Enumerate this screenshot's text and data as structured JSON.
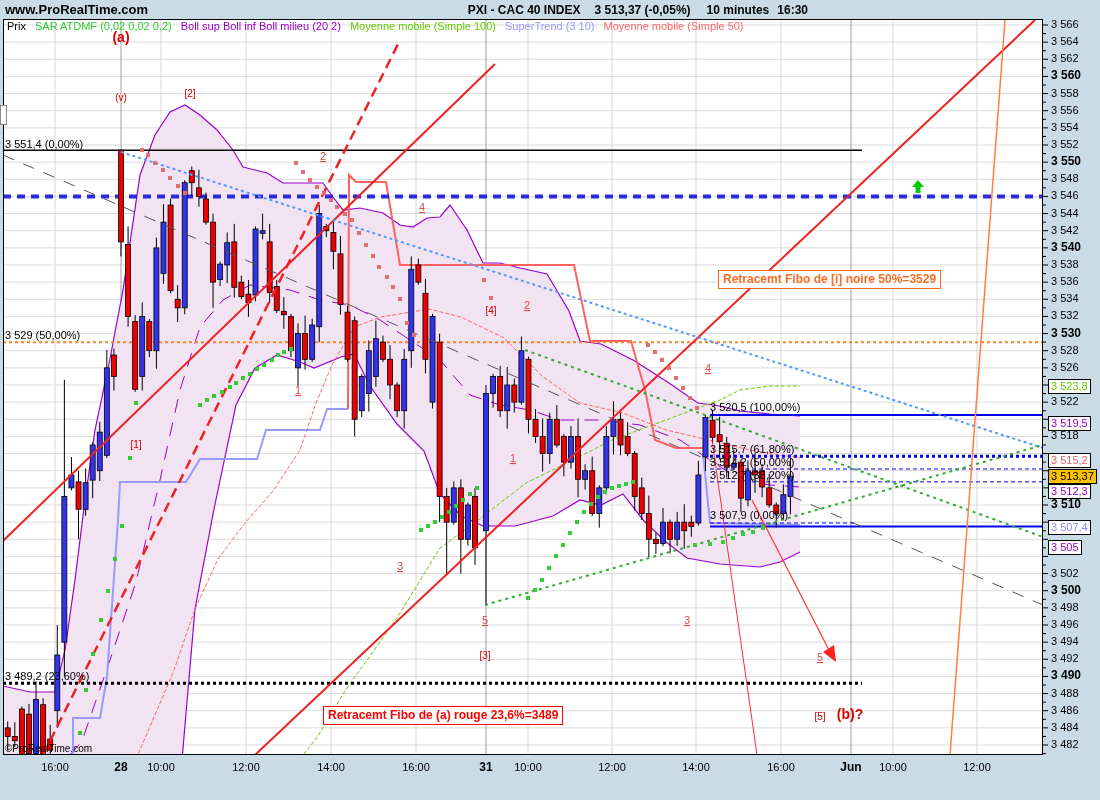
{
  "header": {
    "site": "www.ProRealTime.com",
    "instrument": "PXI - CAC 40 INDEX",
    "quote": "3 513,37 (-0,05%)",
    "timeframe": "10 minutes",
    "time": "16:30"
  },
  "legend": [
    {
      "text": "Prix",
      "color": "#000000"
    },
    {
      "text": "SAR ATDMF (0,02 0,02 0,2)",
      "color": "#33cc33"
    },
    {
      "text": "Boll sup Boll inf Boll milieu (20 2)",
      "color": "#9900cc"
    },
    {
      "text": "Moyenne mobile (Simple 100)",
      "color": "#66cc00"
    },
    {
      "text": "SuperTrend (3 10)",
      "color": "#9999ff"
    },
    {
      "text": "Moyenne mobile (Simple 50)",
      "color": "#ff6666"
    }
  ],
  "wave_labels": [
    {
      "text": "(a)",
      "kind": "major"
    },
    {
      "text": "(v)",
      "kind": "bracket"
    },
    {
      "text": "[2]",
      "kind": "bracket"
    },
    {
      "text": "2",
      "kind": "minor"
    },
    {
      "text": "4",
      "kind": "minor"
    },
    {
      "text": "[4]",
      "kind": "bracket"
    },
    {
      "text": "2",
      "kind": "minor"
    },
    {
      "text": "4",
      "kind": "minor"
    },
    {
      "text": "1",
      "kind": "minor"
    },
    {
      "text": "[1]",
      "kind": "bracket"
    },
    {
      "text": "1",
      "kind": "minor"
    },
    {
      "text": "3",
      "kind": "minor"
    },
    {
      "text": "5",
      "kind": "minor"
    },
    {
      "text": "3",
      "kind": "minor"
    },
    {
      "text": "[3]",
      "kind": "bracket"
    },
    {
      "text": "5",
      "kind": "minor"
    },
    {
      "text": "[5]",
      "kind": "bracket"
    },
    {
      "text": "(b)?",
      "kind": "major"
    }
  ],
  "level_labels": [
    "3 551,4 (0,00%)",
    "3 529 (50,00%)",
    "3 489,2 (23,60%)",
    "3 520,5 (100,00%)",
    "3 515,7 (61,80%)",
    "3 514,2 (50,00%)",
    "3 512,7 (38,20%)",
    "3 507,9 (0,00%)"
  ],
  "notes": [
    {
      "text": "Retracemt Fibo de [i] noire 50%=3529",
      "color": "#ff6a21"
    },
    {
      "text": "Retracemt Fibo de (a) rouge 23,6%=3489",
      "color": "#ff0000"
    }
  ],
  "copyright": "©ProRealTime.com",
  "price_axis": {
    "labels": [
      {
        "text": "3 566",
        "major": false
      },
      {
        "text": "3 564",
        "major": false
      },
      {
        "text": "3 562",
        "major": false
      },
      {
        "text": "3 560",
        "major": true
      },
      {
        "text": "3 558",
        "major": false
      },
      {
        "text": "3 556",
        "major": false
      },
      {
        "text": "3 554",
        "major": false
      },
      {
        "text": "3 552",
        "major": false
      },
      {
        "text": "3 550",
        "major": true
      },
      {
        "text": "3 548",
        "major": false
      },
      {
        "text": "3 546",
        "major": false
      },
      {
        "text": "3 544",
        "major": false
      },
      {
        "text": "3 542",
        "major": false
      },
      {
        "text": "3 540",
        "major": true
      },
      {
        "text": "3 538",
        "major": false
      },
      {
        "text": "3 536",
        "major": false
      },
      {
        "text": "3 534",
        "major": false
      },
      {
        "text": "3 532",
        "major": false
      },
      {
        "text": "3 530",
        "major": true
      },
      {
        "text": "3 528",
        "major": false
      },
      {
        "text": "3 526",
        "major": false
      },
      {
        "text": "3 522",
        "major": false
      },
      {
        "text": "3 518",
        "major": false
      },
      {
        "text": "3 510",
        "major": true
      },
      {
        "text": "3 502",
        "major": false
      },
      {
        "text": "3 500",
        "major": true
      },
      {
        "text": "3 498",
        "major": false
      },
      {
        "text": "3 496",
        "major": false
      },
      {
        "text": "3 494",
        "major": false
      },
      {
        "text": "3 492",
        "major": false
      },
      {
        "text": "3 490",
        "major": true
      },
      {
        "text": "3 488",
        "major": false
      },
      {
        "text": "3 486",
        "major": false
      },
      {
        "text": "3 484",
        "major": false
      },
      {
        "text": "3 482",
        "major": false
      }
    ]
  },
  "price_tags": [
    {
      "text": "3 523,8",
      "kind": "indicator",
      "color": "#66cc00"
    },
    {
      "text": "3 519,5",
      "kind": "indicator",
      "color": "#9900cc"
    },
    {
      "text": "3 515,2",
      "kind": "indicator",
      "color": "#e06060"
    },
    {
      "text": "3 513,37",
      "kind": "current",
      "color": "#ffc000"
    },
    {
      "text": "3 512,3",
      "kind": "indicator",
      "color": "#9900cc"
    },
    {
      "text": "3 507,4",
      "kind": "indicator",
      "color": "#8888ff"
    },
    {
      "text": "3 505",
      "kind": "indicator",
      "color": "#9900cc"
    }
  ],
  "time_axis": {
    "labels": [
      {
        "text": "16:00",
        "major": false
      },
      {
        "text": "28",
        "major": true
      },
      {
        "text": "10:00",
        "major": false
      },
      {
        "text": "12:00",
        "major": false
      },
      {
        "text": "14:00",
        "major": false
      },
      {
        "text": "16:00",
        "major": false
      },
      {
        "text": "31",
        "major": true
      },
      {
        "text": "10:00",
        "major": false
      },
      {
        "text": "12:00",
        "major": false
      },
      {
        "text": "14:00",
        "major": false
      },
      {
        "text": "16:00",
        "major": false
      },
      {
        "text": "Jun",
        "major": true
      },
      {
        "text": "10:00",
        "major": false
      },
      {
        "text": "12:00",
        "major": false
      }
    ]
  }
}
